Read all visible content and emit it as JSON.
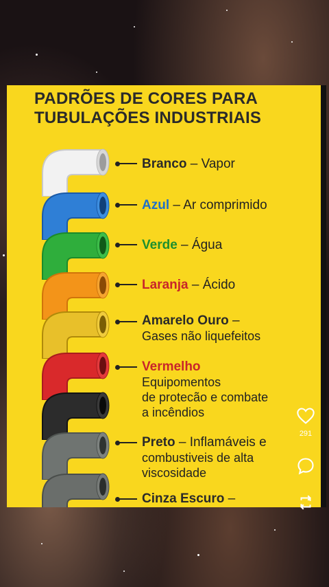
{
  "poster": {
    "title_line1": "PADRÕES DE CORES PARA",
    "title_line2": "TUBULAÇÕES INDUSTRIAIS",
    "items": [
      {
        "name": "Branco",
        "sep": " – ",
        "desc": "Vapor",
        "name_color": "#2a2a2a",
        "pipe_color": "#f2f2f2",
        "pipe_shade": "#c9c9c9"
      },
      {
        "name": "Azul",
        "sep": " – ",
        "desc": "Ar comprimido",
        "name_color": "#1e6fc9",
        "pipe_color": "#2f7fd6",
        "pipe_shade": "#1a5aa8"
      },
      {
        "name": "Verde",
        "sep": " – ",
        "desc": "Água",
        "name_color": "#1d8f2e",
        "pipe_color": "#2fae3c",
        "pipe_shade": "#1c8a2a"
      },
      {
        "name": "Laranja",
        "sep": " – ",
        "desc": "Ácido",
        "name_color": "#c8262a",
        "pipe_color": "#f39419",
        "pipe_shade": "#d0740a"
      },
      {
        "name": "Amarelo Ouro",
        "sep": " –",
        "desc": "",
        "desc2": "Gases não liquefeitos",
        "name_color": "#2a2a2a",
        "pipe_color": "#e8c02a",
        "pipe_shade": "#c9a00f"
      },
      {
        "name": "Vermelho",
        "sep": "",
        "desc": "",
        "desc2": "Equipomentos",
        "desc3": "de protecão e combate",
        "desc4": "a incêndios",
        "name_color": "#c8262a",
        "pipe_color": "#d9292b",
        "pipe_shade": "#a91c1e"
      },
      {
        "name": "",
        "pipe_color": "#2c2c2c",
        "pipe_shade": "#141414"
      },
      {
        "name": "Preto",
        "sep": " – ",
        "desc": "Inflamáveis e",
        "desc2": "combustiveis de alta",
        "desc3": "viscosidade",
        "name_color": "#2a2a2a",
        "pipe_color": "#6f7471",
        "pipe_shade": "#4f5451"
      },
      {
        "name": "Cinza Escuro",
        "sep": " –",
        "desc": "",
        "name_color": "#2a2a2a",
        "pipe_color": "#6a6e6b",
        "pipe_shade": "#4a4e4b"
      }
    ]
  },
  "actions": {
    "like_count": "291",
    "like_icon": "heart-icon",
    "comment_icon": "comment-icon",
    "share_icon": "repost-icon"
  }
}
